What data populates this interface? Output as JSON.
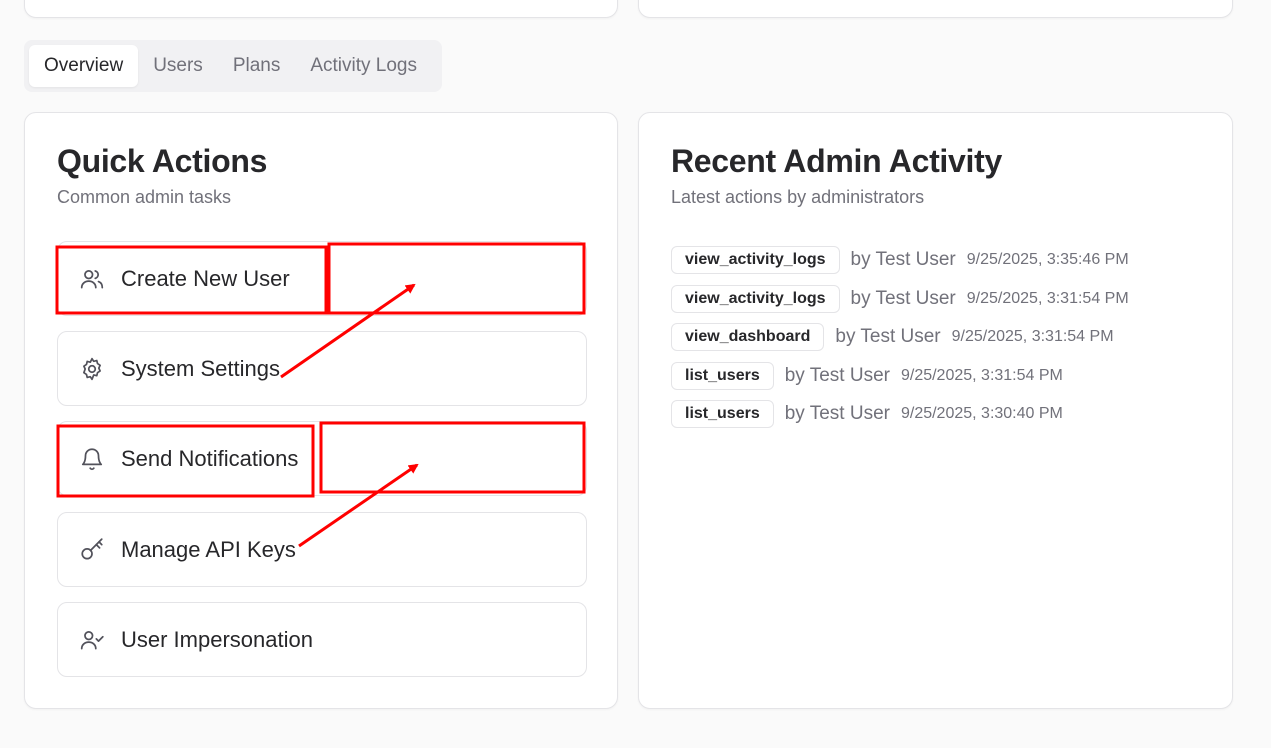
{
  "tabs": [
    {
      "label": "Overview",
      "active": true
    },
    {
      "label": "Users",
      "active": false
    },
    {
      "label": "Plans",
      "active": false
    },
    {
      "label": "Activity Logs",
      "active": false
    }
  ],
  "quick_actions": {
    "title": "Quick Actions",
    "subtitle": "Common admin tasks",
    "items": [
      {
        "label": "Create New User",
        "icon": "users-icon"
      },
      {
        "label": "System Settings",
        "icon": "gear-icon"
      },
      {
        "label": "Send Notifications",
        "icon": "bell-icon"
      },
      {
        "label": "Manage API Keys",
        "icon": "key-icon"
      },
      {
        "label": "User Impersonation",
        "icon": "user-check-icon"
      }
    ]
  },
  "recent_activity": {
    "title": "Recent Admin Activity",
    "subtitle": "Latest actions by administrators",
    "items": [
      {
        "action": "view_activity_logs",
        "by": "by Test User",
        "time": "9/25/2025, 3:35:46 PM"
      },
      {
        "action": "view_activity_logs",
        "by": "by Test User",
        "time": "9/25/2025, 3:31:54 PM"
      },
      {
        "action": "view_dashboard",
        "by": "by Test User",
        "time": "9/25/2025, 3:31:54 PM"
      },
      {
        "action": "list_users",
        "by": "by Test User",
        "time": "9/25/2025, 3:31:54 PM"
      },
      {
        "action": "list_users",
        "by": "by Test User",
        "time": "9/25/2025, 3:30:40 PM"
      }
    ]
  },
  "annotation_color": "#ff0000"
}
